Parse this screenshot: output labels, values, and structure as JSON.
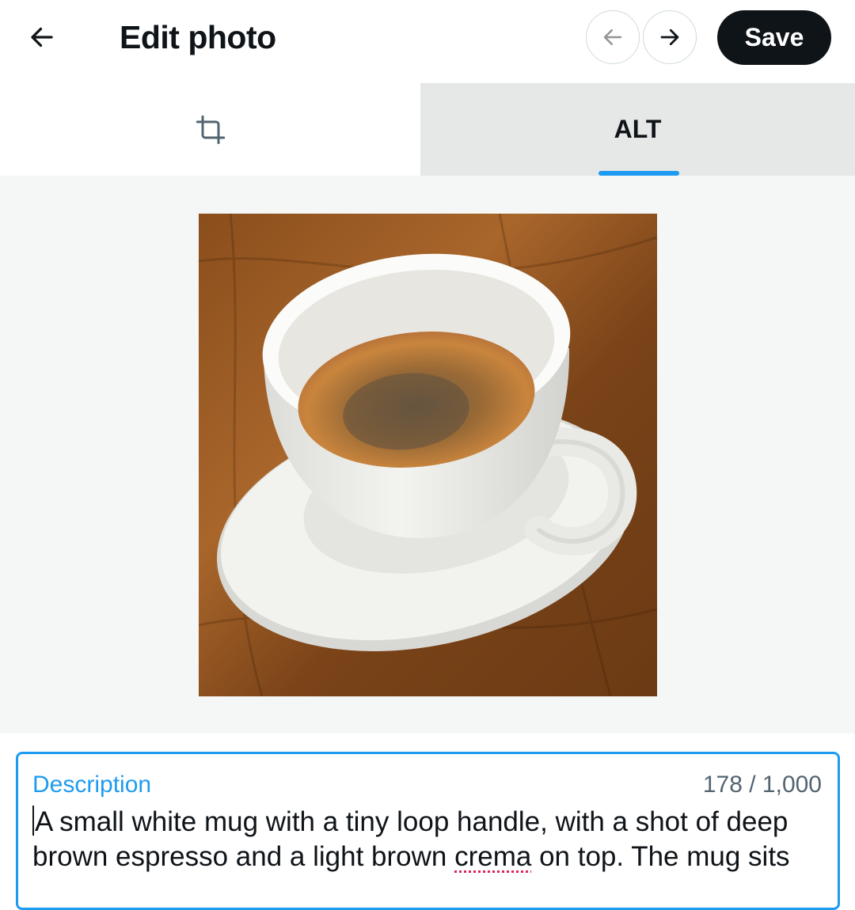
{
  "header": {
    "title": "Edit photo",
    "save_label": "Save",
    "back_icon": "arrow-left-icon",
    "prev_icon": "arrow-left-icon",
    "next_icon": "arrow-right-icon"
  },
  "tabs": {
    "crop_icon": "crop-icon",
    "alt_label": "ALT",
    "active": "ALT",
    "indicator_color": "#1d9bf0"
  },
  "image": {
    "subject": "espresso cup on saucer"
  },
  "description": {
    "label": "Description",
    "count": "178 / 1,000",
    "text_before": "A small white mug with a tiny loop handle, with a shot of deep brown espresso and a light brown ",
    "misspelled": "crema",
    "text_after": " on top. The mug sits"
  },
  "colors": {
    "accent": "#1d9bf0",
    "save_bg": "#0f1419"
  }
}
